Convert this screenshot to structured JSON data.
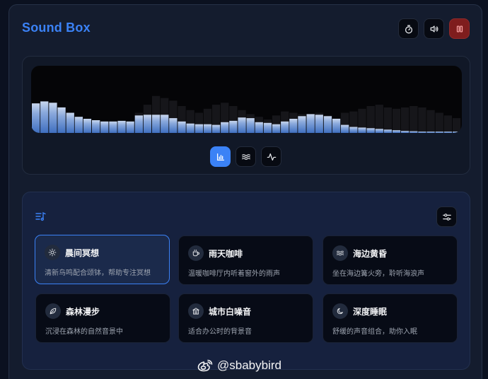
{
  "app": {
    "title": "Sound Box"
  },
  "header": {
    "buttons": [
      {
        "name": "timer-button",
        "icon": "timer-icon"
      },
      {
        "name": "volume-button",
        "icon": "volume-icon"
      },
      {
        "name": "stop-button",
        "icon": "stop-icon"
      }
    ]
  },
  "visualizer": {
    "modes": [
      {
        "icon": "bar-chart-icon",
        "active": true
      },
      {
        "icon": "wave-icon",
        "active": false
      },
      {
        "icon": "pulse-icon",
        "active": false
      }
    ],
    "levels": [
      0.44,
      0.47,
      0.45,
      0.38,
      0.3,
      0.24,
      0.21,
      0.19,
      0.17,
      0.17,
      0.18,
      0.17,
      0.26,
      0.27,
      0.27,
      0.27,
      0.22,
      0.17,
      0.14,
      0.13,
      0.13,
      0.12,
      0.16,
      0.18,
      0.23,
      0.22,
      0.16,
      0.15,
      0.13,
      0.17,
      0.21,
      0.25,
      0.28,
      0.27,
      0.25,
      0.21,
      0.12,
      0.09,
      0.08,
      0.07,
      0.06,
      0.05,
      0.04,
      0.03,
      0.025,
      0.02,
      0.02,
      0.02,
      0.02,
      0.02
    ],
    "ghost_levels": [
      0.0,
      0.0,
      0.0,
      0.0,
      0.0,
      0.0,
      0.0,
      0.0,
      0.0,
      0.0,
      0.0,
      0.0,
      0.3,
      0.42,
      0.55,
      0.52,
      0.48,
      0.4,
      0.34,
      0.3,
      0.36,
      0.42,
      0.45,
      0.4,
      0.34,
      0.28,
      0.24,
      0.2,
      0.26,
      0.32,
      0.3,
      0.28,
      0.26,
      0.3,
      0.26,
      0.22,
      0.3,
      0.32,
      0.36,
      0.4,
      0.42,
      0.38,
      0.36,
      0.38,
      0.4,
      0.38,
      0.34,
      0.3,
      0.26,
      0.22
    ]
  },
  "scenes": {
    "header_icon": "music-list-icon",
    "settings_icon": "sliders-icon",
    "items": [
      {
        "icon": "sun-icon",
        "name": "晨间冥想",
        "desc": "清新鸟鸣配合颂钵，帮助专注冥想",
        "selected": true
      },
      {
        "icon": "coffee-icon",
        "name": "雨天咖啡",
        "desc": "温暖咖啡厅内听着窗外的雨声",
        "selected": false
      },
      {
        "icon": "waves-icon",
        "name": "海边黄昏",
        "desc": "坐在海边篝火旁，聆听海浪声",
        "selected": false
      },
      {
        "icon": "leaf-icon",
        "name": "森林漫步",
        "desc": "沉浸在森林的自然音景中",
        "selected": false
      },
      {
        "icon": "city-icon",
        "name": "城市白噪音",
        "desc": "适合办公时的背景音",
        "selected": false
      },
      {
        "icon": "moon-icon",
        "name": "深度睡眠",
        "desc": "舒缓的声音组合，助你入眠",
        "selected": false
      }
    ]
  },
  "watermark": {
    "text": "@sbabybird",
    "icon": "weibo-icon"
  }
}
